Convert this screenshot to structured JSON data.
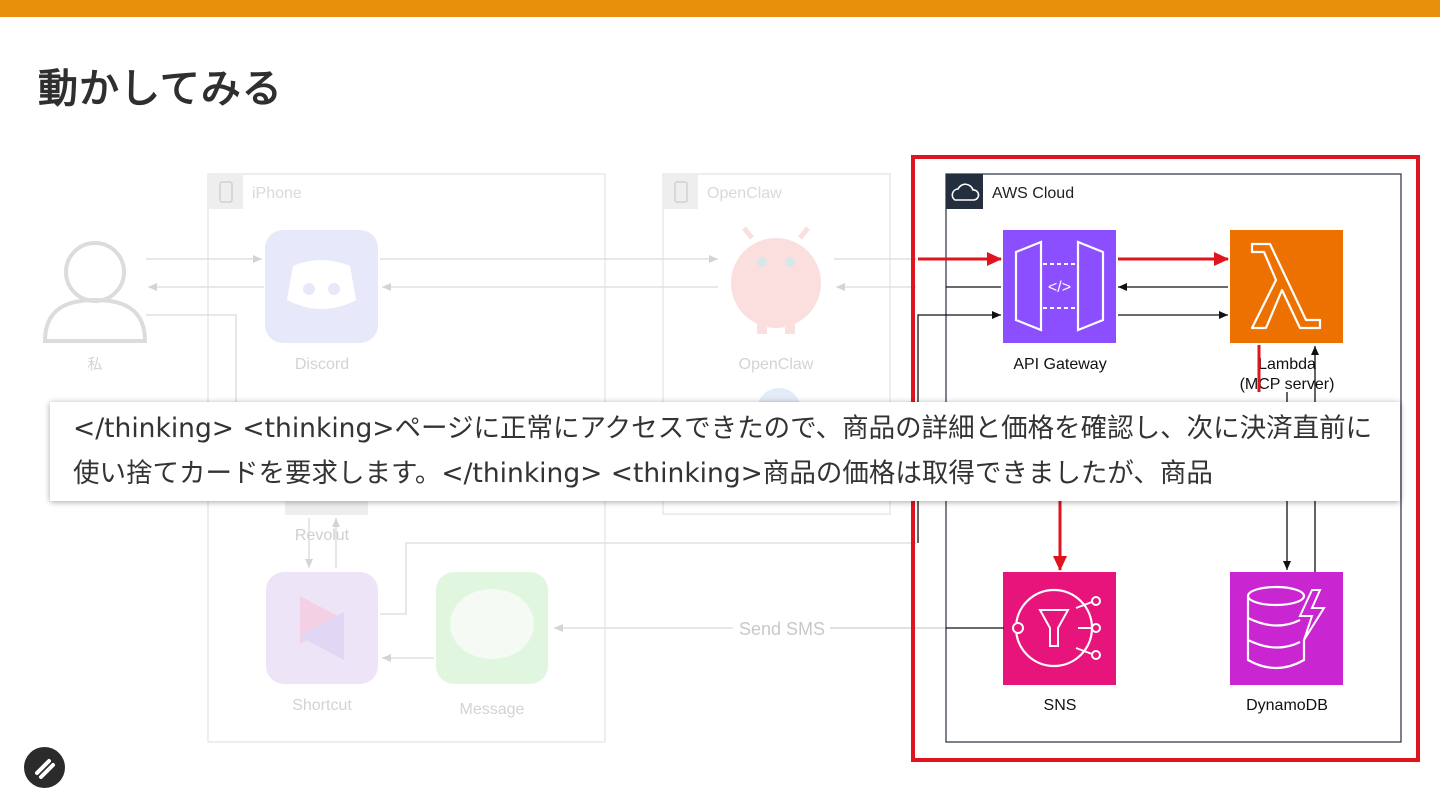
{
  "slide": {
    "title": "動かしてみる",
    "accent_color": "#E8900C"
  },
  "diagram": {
    "user_label": "私",
    "iphone_group_label": "iPhone",
    "openclaw_group_label": "OpenClaw",
    "aws_group_label": "AWS Cloud",
    "nodes": {
      "discord": "Discord",
      "openclaw": "OpenClaw",
      "revolut": "Revolut",
      "shortcut": "Shortcut",
      "message": "Message",
      "api_gateway": "API Gateway",
      "lambda_line1": "Lambda",
      "lambda_line2": "(MCP server)",
      "sns": "SNS",
      "dynamodb": "DynamoDB"
    },
    "edge_labels": {
      "send_sms": "Send SMS"
    },
    "colors": {
      "highlight": "#E0141E",
      "api_gateway": "#8C4FFF",
      "lambda": "#ED7100",
      "sns": "#E7157B",
      "dynamodb": "#C925D1"
    }
  },
  "caption": {
    "text": "</thinking> <thinking>ページに正常にアクセスできたので、商品の詳細と価格を確認し、次に決済直前に使い捨てカードを要求します。</thinking> <thinking>商品の価格は取得できましたが、商品"
  }
}
